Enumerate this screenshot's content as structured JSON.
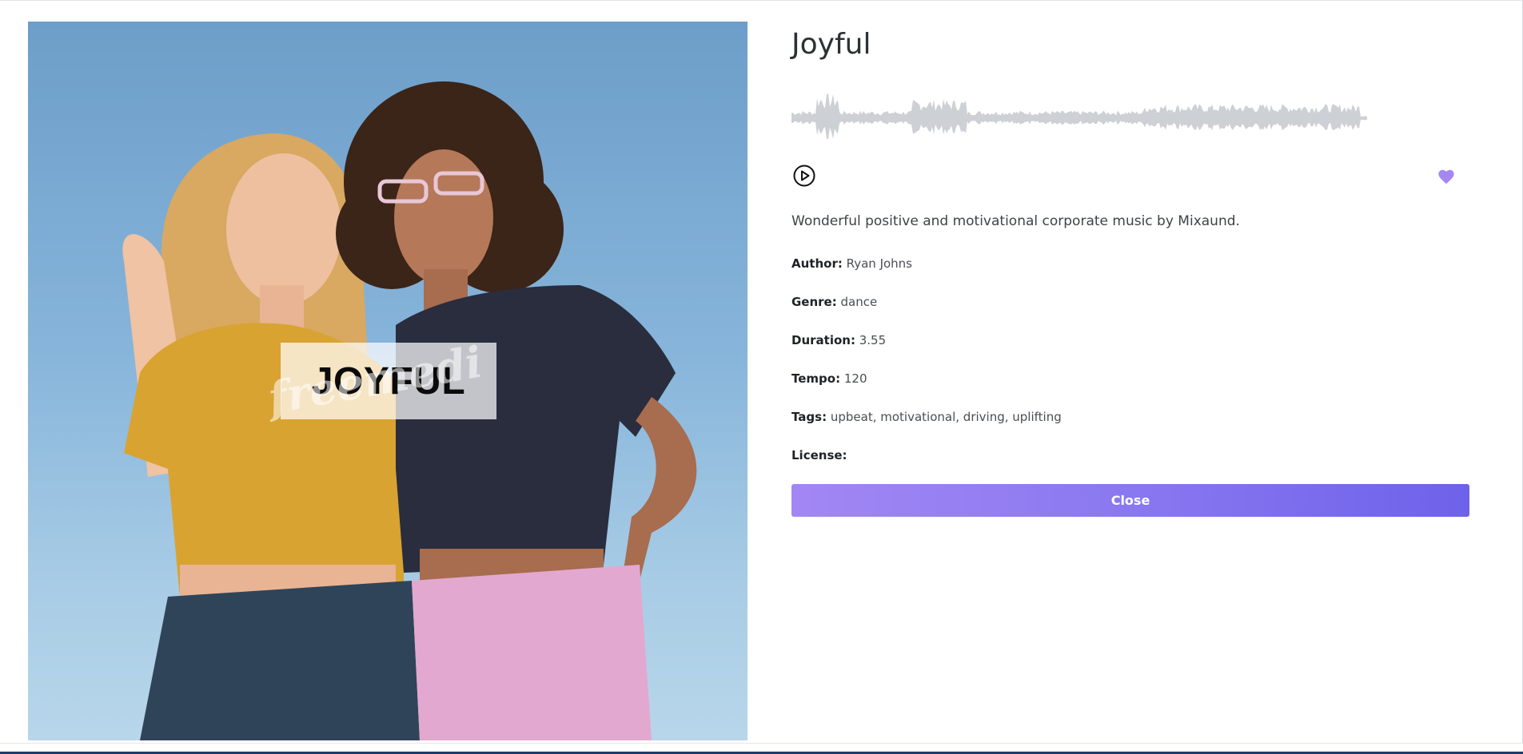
{
  "cover": {
    "title": "JOYFUL",
    "watermark": "freemedi"
  },
  "track": {
    "title": "Joyful",
    "description": "Wonderful positive and motivational corporate music by Mixaund."
  },
  "meta": {
    "author_label": "Author:",
    "author_value": "Ryan Johns",
    "genre_label": "Genre:",
    "genre_value": "dance",
    "duration_label": "Duration:",
    "duration_value": "3.55",
    "tempo_label": "Tempo:",
    "tempo_value": "120",
    "tags_label": "Tags:",
    "tags_value": "upbeat, motivational, driving, uplifting",
    "license_label": "License:",
    "license_value": ""
  },
  "actions": {
    "close_label": "Close"
  },
  "icons": {
    "play": "play-circle-icon",
    "like": "heart-icon"
  },
  "colors": {
    "accent_start": "#a287f4",
    "accent_end": "#6e62ea",
    "heart": "#a487f0",
    "waveform": "#cdd0d4"
  }
}
